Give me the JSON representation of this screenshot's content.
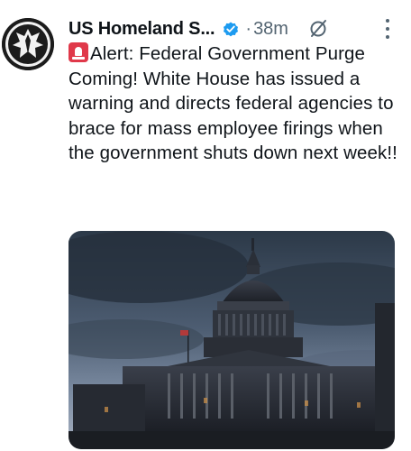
{
  "tweet": {
    "account_name": "US Homeland S...",
    "separator": "·",
    "time": "38m",
    "alert_icon": "police-siren-emoji",
    "text": "Alert: Federal Government Purge Coming! White House has issued a warning and directs federal agencies to brace for mass employee firings when the government shuts down next week!!",
    "media_subject": "us-capitol-building-dusk-photo",
    "icons": [
      "avatar-shield-logo",
      "verified-badge-icon",
      "grok-icon",
      "more-options-icon"
    ]
  },
  "colors": {
    "verified_badge": "#1d9bf0",
    "secondary_text": "#536471",
    "siren_red": "#e0394a"
  }
}
